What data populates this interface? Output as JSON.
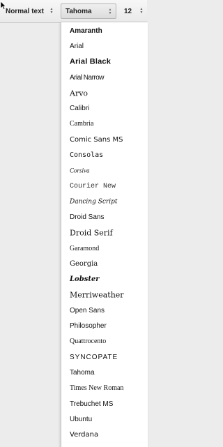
{
  "toolbar": {
    "style_select": "Normal text",
    "font_select": "Tahoma",
    "size_select": "12"
  },
  "font_menu": {
    "items": [
      "Amaranth",
      "Arial",
      "Arial Black",
      "Arial Narrow",
      "Arvo",
      "Calibri",
      "Cambria",
      "Comic Sans MS",
      "Consolas",
      "Corsiva",
      "Courier New",
      "Dancing Script",
      "Droid Sans",
      "Droid Serif",
      "Garamond",
      "Georgia",
      "Lobster",
      "Merriweather",
      "Open Sans",
      "Philosopher",
      "Quattrocento",
      "SYNCOPATE",
      "Tahoma",
      "Times New Roman",
      "Trebuchet MS",
      "Ubuntu",
      "Verdana"
    ]
  }
}
